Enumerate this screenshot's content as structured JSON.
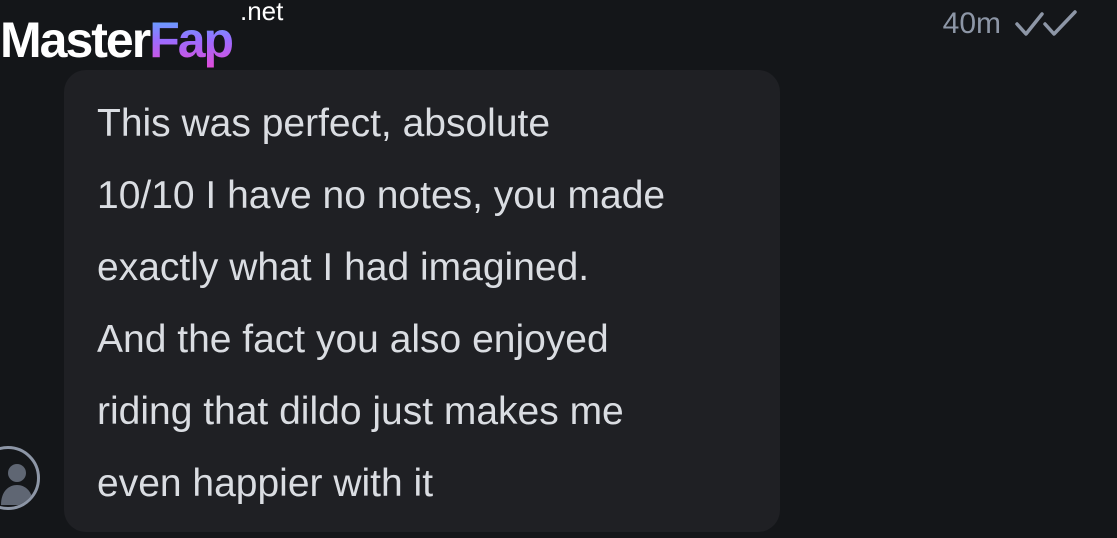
{
  "watermark": {
    "part1": "Master",
    "part2": "Fap",
    "suffix": ".net"
  },
  "message": {
    "timestamp": "40m",
    "status_icon": "double-check-icon",
    "text": "This was perfect, absolute\n10/10 I have no notes, you made\nexactly what I had imagined.\nAnd the fact you also enjoyed\nriding that dildo just makes me\neven happier with it"
  },
  "sender": {
    "avatar_icon": "person-icon"
  },
  "colors": {
    "background": "#141619",
    "bubble": "#1f2024",
    "text": "#dadde2",
    "meta": "#8d96a6"
  }
}
